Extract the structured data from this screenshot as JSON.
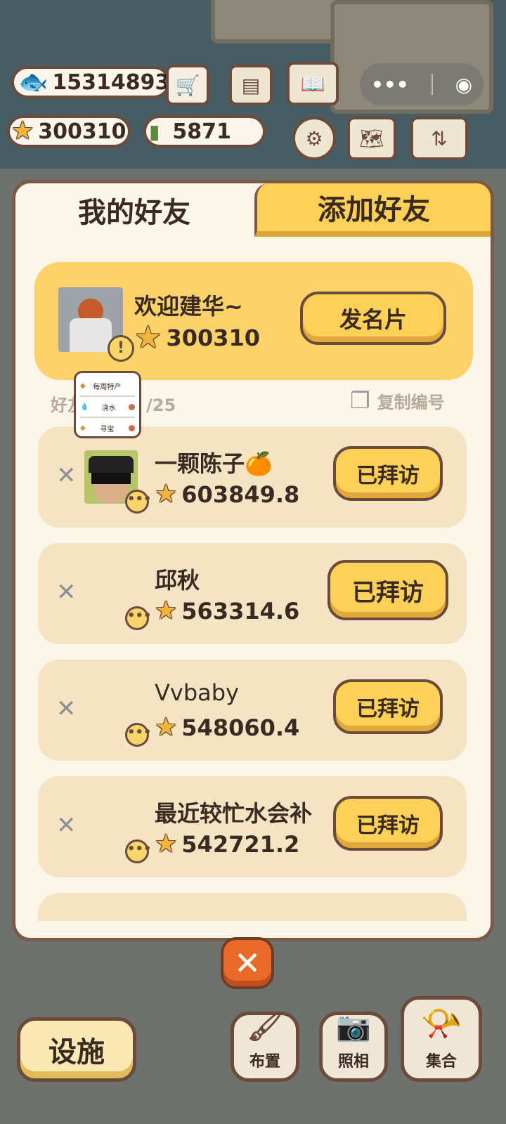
{
  "hud": {
    "fish_count": "15314893",
    "star_count": "300310",
    "ticket_count": "5871"
  },
  "tabs": {
    "mine": "我的好友",
    "add": "添加好友"
  },
  "profile": {
    "greeting": "欢迎建华~",
    "score": "300310",
    "card_button": "发名片"
  },
  "friends_meta": {
    "count_label": "好友",
    "count_suffix": "/25",
    "copy_id": "复制编号"
  },
  "popup": {
    "items": [
      "每周特产",
      "浇水",
      "寻宝"
    ]
  },
  "friends": [
    {
      "name": "一颗陈子🍊",
      "score": "603849.8",
      "button": "已拜访"
    },
    {
      "name": "邱秋",
      "score": "563314.6",
      "button": "已拜访"
    },
    {
      "name": "Vvbaby",
      "score": "548060.4",
      "button": "已拜访"
    },
    {
      "name": "最近较忙水会补",
      "score": "542721.2",
      "button": "已拜访"
    }
  ],
  "bottom": {
    "facility": "设施",
    "arrange": "布置",
    "photo": "照相",
    "gather": "集合"
  }
}
